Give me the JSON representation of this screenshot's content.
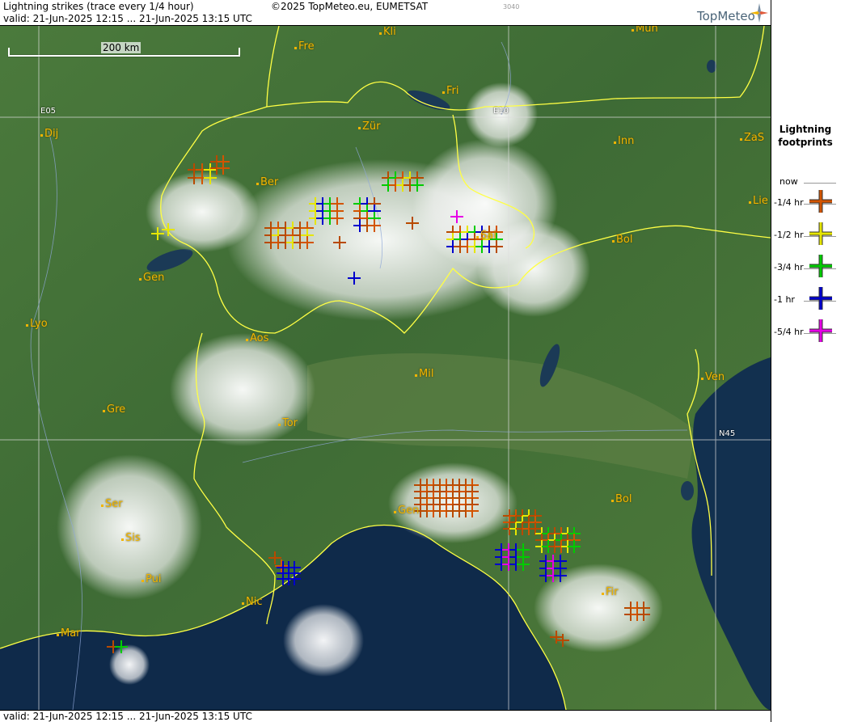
{
  "header": {
    "title": "Lightning strikes (trace every 1/4 hour)",
    "valid": "valid:  21-Jun-2025 12:15 ... 21-Jun-2025 13:15 UTC",
    "copyright": "©2025 TopMeteo.eu, EUMETSAT",
    "small_code": "3040",
    "logo_text": "TopMeteo"
  },
  "footer": {
    "valid": "valid:  21-Jun-2025 12:15 ... 21-Jun-2025 13:15 UTC"
  },
  "scale": {
    "label": "200 km"
  },
  "grid_labels": [
    {
      "text": "E05"
    },
    {
      "text": "E10"
    },
    {
      "text": "N45"
    }
  ],
  "cities": [
    "Kli",
    "Mün",
    "Fre",
    "Fri",
    "Zür",
    "Dij",
    "Inn",
    "ZaS",
    "Ber",
    "Lie",
    "Bol",
    "Gen",
    "Lyo",
    "Aos",
    "Mil",
    "Ven",
    "Gre",
    "Tor",
    "Ser",
    "Bol",
    "Gen",
    "Sis",
    "Pui",
    "Nic",
    "Fir",
    "Mar",
    "Sai"
  ],
  "legend": {
    "title_line1": "Lightning",
    "title_line2": "footprints",
    "items": [
      {
        "label": "now",
        "color": ""
      },
      {
        "label": "-1/4 hr",
        "color": "#d35400"
      },
      {
        "label": "-1/2 hr",
        "color": "#e6e600"
      },
      {
        "label": "-3/4 hr",
        "color": "#00cc00"
      },
      {
        "label": "-1 hr",
        "color": "#0000cc"
      },
      {
        "label": "-5/4 hr",
        "color": "#e600e6"
      }
    ]
  },
  "colors": {
    "strike_newest": "#b84a00",
    "strike_orange": "#d35400",
    "strike_yellow": "#e6e600",
    "strike_green": "#00cc00",
    "strike_blue": "#0000cc",
    "strike_magenta": "#e600e6",
    "border": "#ffff44",
    "land": "#3f6a34",
    "sea": "#0f2a4a"
  }
}
